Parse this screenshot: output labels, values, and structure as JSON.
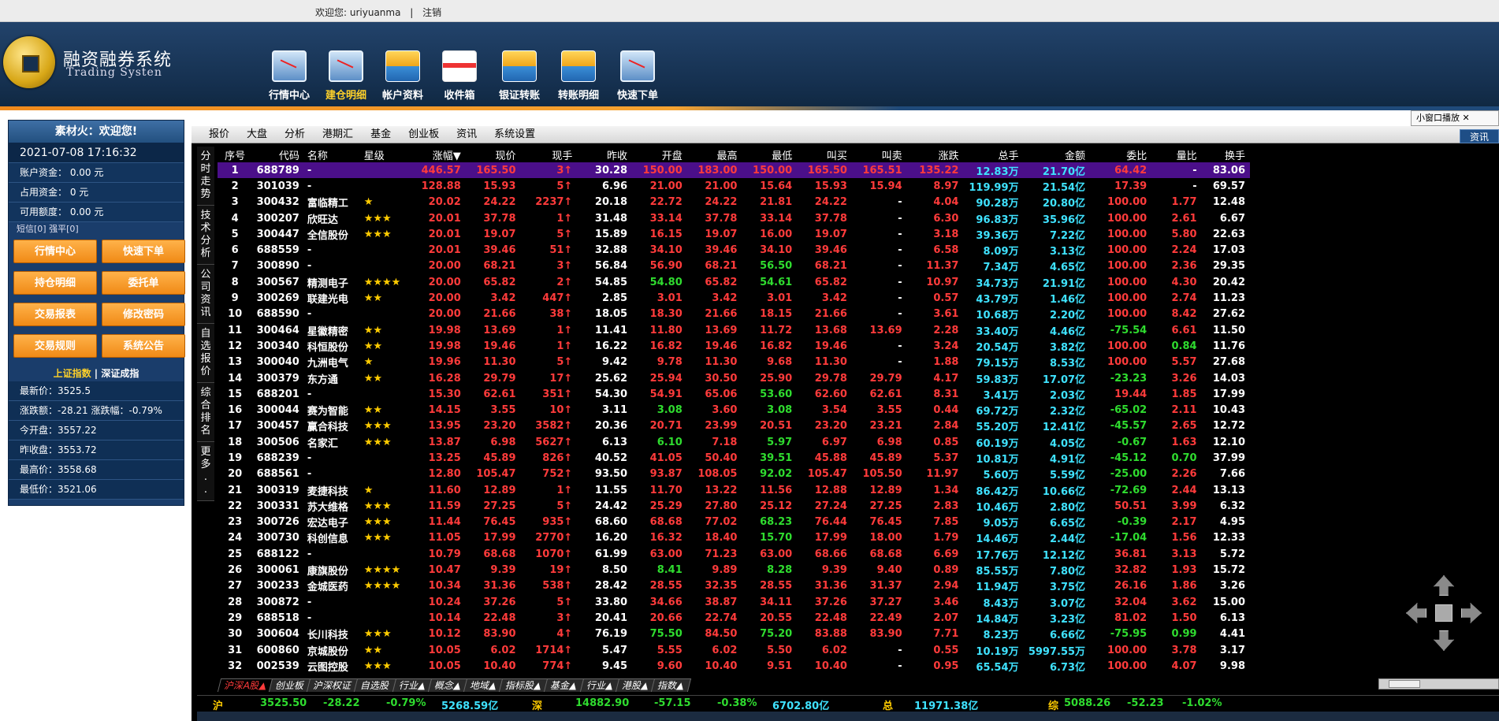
{
  "top": {
    "welcome": "欢迎您: uriyuanma",
    "sep": "|",
    "logout": "注销"
  },
  "logo": {
    "title": "融资融券系统",
    "subtitle": "Trading Systen"
  },
  "nav": [
    {
      "label": "行情中心",
      "icon": "monitor-chart-icon"
    },
    {
      "label": "建仓明细",
      "icon": "monitor-chart-icon",
      "active": true
    },
    {
      "label": "帐户资料",
      "icon": "card-icon"
    },
    {
      "label": "收件箱",
      "icon": "gift-icon"
    },
    {
      "label": "银证转账",
      "icon": "card-icon"
    },
    {
      "label": "转账明细",
      "icon": "card-icon"
    },
    {
      "label": "快速下单",
      "icon": "monitor-chart-icon"
    }
  ],
  "left": {
    "head": "素材火：欢迎您!",
    "datetime": "2021-07-08 17:16:32",
    "account": [
      "账户资金：  0.00 元",
      "占用资金：  0  元",
      "可用额度：  0.00 元"
    ],
    "note": "短信[0] 强平[0]",
    "buttons": [
      "行情中心",
      "快速下单",
      "持仓明细",
      "委托单",
      "交易报表",
      "修改密码",
      "交易规则",
      "系统公告"
    ],
    "idx_on": "上证指数",
    "idx_sep": " | ",
    "idx_off": "深证成指",
    "quote": [
      "最新价：3525.5",
      "涨跌额：-28.21  涨跌幅：-0.79%",
      "今开盘：3557.22",
      "昨收盘：3553.72",
      "最高价：3558.68",
      "最低价：3521.06"
    ]
  },
  "menu": [
    "报价",
    "大盘",
    "分析",
    "港期汇",
    "基金",
    "创业板",
    "资讯",
    "系统设置"
  ],
  "mini": "小窗口播放",
  "ziliao": "资讯",
  "vtabs": [
    "分时走势",
    "技术分析",
    "公司资讯",
    "自选报价",
    "综合排名",
    "更多.."
  ],
  "columns": [
    "序号",
    "代码",
    "名称",
    "星级",
    "涨幅▼",
    "现价",
    "现手",
    "昨收",
    "开盘",
    "最高",
    "最低",
    "叫买",
    "叫卖",
    "涨跌",
    "总手",
    "金额",
    "委比",
    "量比",
    "换手"
  ],
  "rows": [
    [
      "1",
      "688789",
      "-",
      "",
      "446.57",
      "165.50",
      "3↑",
      "30.28",
      "150.00",
      "183.00",
      "150.00",
      "165.50",
      "165.51",
      "135.22",
      "12.83万",
      "21.70亿",
      "64.42",
      "-",
      "83.06"
    ],
    [
      "2",
      "301039",
      "-",
      "",
      "128.88",
      "15.93",
      "5↑",
      "6.96",
      "21.00",
      "21.00",
      "15.64",
      "15.93",
      "15.94",
      "8.97",
      "119.99万",
      "21.54亿",
      "17.39",
      "-",
      "69.57"
    ],
    [
      "3",
      "300432",
      "富临精工",
      "★",
      "20.02",
      "24.22",
      "2237↑",
      "20.18",
      "22.72",
      "24.22",
      "21.81",
      "24.22",
      "-",
      "4.04",
      "90.28万",
      "20.80亿",
      "100.00",
      "1.77",
      "12.48"
    ],
    [
      "4",
      "300207",
      "欣旺达",
      "★★★",
      "20.01",
      "37.78",
      "1↑",
      "31.48",
      "33.14",
      "37.78",
      "33.14",
      "37.78",
      "-",
      "6.30",
      "96.83万",
      "35.96亿",
      "100.00",
      "2.61",
      "6.67"
    ],
    [
      "5",
      "300447",
      "全信股份",
      "★★★",
      "20.01",
      "19.07",
      "5↑",
      "15.89",
      "16.15",
      "19.07",
      "16.00",
      "19.07",
      "-",
      "3.18",
      "39.36万",
      "7.22亿",
      "100.00",
      "5.80",
      "22.63"
    ],
    [
      "6",
      "688559",
      "-",
      "",
      "20.01",
      "39.46",
      "51↑",
      "32.88",
      "34.10",
      "39.46",
      "34.10",
      "39.46",
      "-",
      "6.58",
      "8.09万",
      "3.13亿",
      "100.00",
      "2.24",
      "17.03"
    ],
    [
      "7",
      "300890",
      "-",
      "",
      "20.00",
      "68.21",
      "3↑",
      "56.84",
      "56.90",
      "68.21",
      "56.50",
      "68.21",
      "-",
      "11.37",
      "7.34万",
      "4.65亿",
      "100.00",
      "2.36",
      "29.35"
    ],
    [
      "8",
      "300567",
      "精测电子",
      "★★★★",
      "20.00",
      "65.82",
      "2↑",
      "54.85",
      "54.80",
      "65.82",
      "54.61",
      "65.82",
      "-",
      "10.97",
      "34.73万",
      "21.91亿",
      "100.00",
      "4.30",
      "20.42"
    ],
    [
      "9",
      "300269",
      "联建光电",
      "★★",
      "20.00",
      "3.42",
      "447↑",
      "2.85",
      "3.01",
      "3.42",
      "3.01",
      "3.42",
      "-",
      "0.57",
      "43.79万",
      "1.46亿",
      "100.00",
      "2.74",
      "11.23"
    ],
    [
      "10",
      "688590",
      "-",
      "",
      "20.00",
      "21.66",
      "38↑",
      "18.05",
      "18.30",
      "21.66",
      "18.15",
      "21.66",
      "-",
      "3.61",
      "10.68万",
      "2.20亿",
      "100.00",
      "8.42",
      "27.62"
    ],
    [
      "11",
      "300464",
      "星徽精密",
      "★★",
      "19.98",
      "13.69",
      "1↑",
      "11.41",
      "11.80",
      "13.69",
      "11.72",
      "13.68",
      "13.69",
      "2.28",
      "33.40万",
      "4.46亿",
      "-75.54",
      "6.61",
      "11.50"
    ],
    [
      "12",
      "300340",
      "科恒股份",
      "★★",
      "19.98",
      "19.46",
      "1↑",
      "16.22",
      "16.82",
      "19.46",
      "16.82",
      "19.46",
      "-",
      "3.24",
      "20.54万",
      "3.82亿",
      "100.00",
      "0.84",
      "11.76"
    ],
    [
      "13",
      "300040",
      "九洲电气",
      "★",
      "19.96",
      "11.30",
      "5↑",
      "9.42",
      "9.78",
      "11.30",
      "9.68",
      "11.30",
      "-",
      "1.88",
      "79.15万",
      "8.53亿",
      "100.00",
      "5.57",
      "27.68"
    ],
    [
      "14",
      "300379",
      "东方通",
      "★★",
      "16.28",
      "29.79",
      "17↑",
      "25.62",
      "25.94",
      "30.50",
      "25.90",
      "29.78",
      "29.79",
      "4.17",
      "59.83万",
      "17.07亿",
      "-23.23",
      "3.26",
      "14.03"
    ],
    [
      "15",
      "688201",
      "-",
      "",
      "15.30",
      "62.61",
      "351↑",
      "54.30",
      "54.91",
      "65.06",
      "53.60",
      "62.60",
      "62.61",
      "8.31",
      "3.41万",
      "2.03亿",
      "19.44",
      "1.85",
      "17.99"
    ],
    [
      "16",
      "300044",
      "赛为智能",
      "★★",
      "14.15",
      "3.55",
      "10↑",
      "3.11",
      "3.08",
      "3.60",
      "3.08",
      "3.54",
      "3.55",
      "0.44",
      "69.72万",
      "2.32亿",
      "-65.02",
      "2.11",
      "10.43"
    ],
    [
      "17",
      "300457",
      "赢合科技",
      "★★★",
      "13.95",
      "23.20",
      "3582↑",
      "20.36",
      "20.71",
      "23.99",
      "20.51",
      "23.20",
      "23.21",
      "2.84",
      "55.20万",
      "12.41亿",
      "-45.57",
      "2.65",
      "12.72"
    ],
    [
      "18",
      "300506",
      "名家汇",
      "★★★",
      "13.87",
      "6.98",
      "5627↑",
      "6.13",
      "6.10",
      "7.18",
      "5.97",
      "6.97",
      "6.98",
      "0.85",
      "60.19万",
      "4.05亿",
      "-0.67",
      "1.63",
      "12.10"
    ],
    [
      "19",
      "688239",
      "-",
      "",
      "13.25",
      "45.89",
      "826↑",
      "40.52",
      "41.05",
      "50.40",
      "39.51",
      "45.88",
      "45.89",
      "5.37",
      "10.81万",
      "4.91亿",
      "-45.12",
      "0.70",
      "37.99"
    ],
    [
      "20",
      "688561",
      "-",
      "",
      "12.80",
      "105.47",
      "752↑",
      "93.50",
      "93.87",
      "108.05",
      "92.02",
      "105.47",
      "105.50",
      "11.97",
      "5.60万",
      "5.59亿",
      "-25.00",
      "2.26",
      "7.66"
    ],
    [
      "21",
      "300319",
      "麦捷科技",
      "★",
      "11.60",
      "12.89",
      "1↑",
      "11.55",
      "11.70",
      "13.22",
      "11.56",
      "12.88",
      "12.89",
      "1.34",
      "86.42万",
      "10.66亿",
      "-72.69",
      "2.44",
      "13.13"
    ],
    [
      "22",
      "300331",
      "苏大维格",
      "★★★",
      "11.59",
      "27.25",
      "5↑",
      "24.42",
      "25.29",
      "27.80",
      "25.12",
      "27.24",
      "27.25",
      "2.83",
      "10.46万",
      "2.80亿",
      "50.51",
      "3.99",
      "6.32"
    ],
    [
      "23",
      "300726",
      "宏达电子",
      "★★★",
      "11.44",
      "76.45",
      "935↑",
      "68.60",
      "68.68",
      "77.02",
      "68.23",
      "76.44",
      "76.45",
      "7.85",
      "9.05万",
      "6.65亿",
      "-0.39",
      "2.17",
      "4.95"
    ],
    [
      "24",
      "300730",
      "科创信息",
      "★★★",
      "11.05",
      "17.99",
      "2770↑",
      "16.20",
      "16.32",
      "18.40",
      "15.70",
      "17.99",
      "18.00",
      "1.79",
      "14.46万",
      "2.44亿",
      "-17.04",
      "1.56",
      "12.33"
    ],
    [
      "25",
      "688122",
      "-",
      "",
      "10.79",
      "68.68",
      "1070↑",
      "61.99",
      "63.00",
      "71.23",
      "63.00",
      "68.66",
      "68.68",
      "6.69",
      "17.76万",
      "12.12亿",
      "36.81",
      "3.13",
      "5.72"
    ],
    [
      "26",
      "300061",
      "康旗股份",
      "★★★★",
      "10.47",
      "9.39",
      "19↑",
      "8.50",
      "8.41",
      "9.89",
      "8.28",
      "9.39",
      "9.40",
      "0.89",
      "85.55万",
      "7.80亿",
      "32.82",
      "1.93",
      "15.72"
    ],
    [
      "27",
      "300233",
      "金城医药",
      "★★★★",
      "10.34",
      "31.36",
      "538↑",
      "28.42",
      "28.55",
      "32.35",
      "28.55",
      "31.36",
      "31.37",
      "2.94",
      "11.94万",
      "3.75亿",
      "26.16",
      "1.86",
      "3.26"
    ],
    [
      "28",
      "300872",
      "-",
      "",
      "10.24",
      "37.26",
      "5↑",
      "33.80",
      "34.66",
      "38.87",
      "34.11",
      "37.26",
      "37.27",
      "3.46",
      "8.43万",
      "3.07亿",
      "32.04",
      "3.62",
      "15.00"
    ],
    [
      "29",
      "688518",
      "-",
      "",
      "10.14",
      "22.48",
      "3↑",
      "20.41",
      "20.66",
      "22.74",
      "20.55",
      "22.48",
      "22.49",
      "2.07",
      "14.84万",
      "3.23亿",
      "81.02",
      "1.50",
      "6.13"
    ],
    [
      "30",
      "300604",
      "长川科技",
      "★★★",
      "10.12",
      "83.90",
      "4↑",
      "76.19",
      "75.50",
      "84.50",
      "75.20",
      "83.88",
      "83.90",
      "7.71",
      "8.23万",
      "6.66亿",
      "-75.95",
      "0.99",
      "4.41"
    ],
    [
      "31",
      "600860",
      "京城股份",
      "★★",
      "10.05",
      "6.02",
      "1714↑",
      "5.47",
      "5.55",
      "6.02",
      "5.50",
      "6.02",
      "-",
      "0.55",
      "10.19万",
      "5997.55万",
      "100.00",
      "3.78",
      "3.17"
    ],
    [
      "32",
      "002539",
      "云图控股",
      "★★★",
      "10.05",
      "10.40",
      "774↑",
      "9.45",
      "9.60",
      "10.40",
      "9.51",
      "10.40",
      "-",
      "0.95",
      "65.54万",
      "6.73亿",
      "100.00",
      "4.07",
      "9.98"
    ]
  ],
  "btabs": [
    "沪深A股▲",
    "创业板",
    "沪深权证",
    "自选股",
    "行业▲",
    "概念▲",
    "地域▲",
    "指标股▲",
    "基金▲",
    "行业▲",
    "港股▲",
    "指数▲"
  ],
  "status": [
    {
      "t": "沪",
      "c": "gold"
    },
    {
      "t": "3525.50",
      "c": "g"
    },
    {
      "t": "-28.22",
      "c": "g"
    },
    {
      "t": "-0.79%",
      "c": "g"
    },
    {
      "t": "5268.59亿",
      "c": "cy"
    },
    {
      "t": "深",
      "c": "gold"
    },
    {
      "t": "14882.90",
      "c": "g"
    },
    {
      "t": "-57.15",
      "c": "g"
    },
    {
      "t": "-0.38%",
      "c": "g"
    },
    {
      "t": "6702.80亿",
      "c": "cy"
    },
    {
      "t": "总",
      "c": "gold"
    },
    {
      "t": "11971.38亿",
      "c": "cy"
    },
    {
      "t": "综",
      "c": "gold"
    },
    {
      "t": "5088.26",
      "c": "g"
    },
    {
      "t": "-52.23",
      "c": "g"
    },
    {
      "t": "-1.02%",
      "c": "g"
    }
  ]
}
